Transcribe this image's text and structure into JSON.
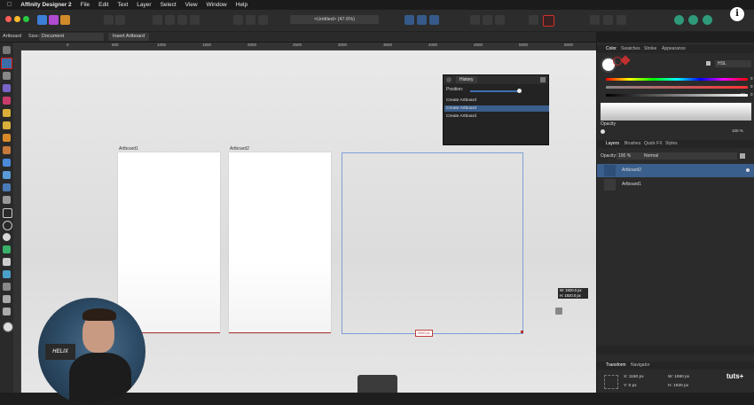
{
  "menubar": {
    "apple": "",
    "items": [
      "Affinity Designer 2",
      "File",
      "Edit",
      "Text",
      "Layer",
      "Select",
      "View",
      "Window",
      "Help"
    ]
  },
  "toolbar": {
    "doc_title": "<Untitled> (47.6%)"
  },
  "context": {
    "artboard_label": "Artboard",
    "size_label": "Size:",
    "size_value": "Document",
    "insert_button": "Insert Artboard"
  },
  "rulers": {
    "top": [
      "0",
      "500",
      "1000",
      "1500",
      "2000",
      "2500",
      "3000",
      "3500",
      "4000",
      "4500",
      "5000",
      "5500",
      "6000",
      "6500"
    ]
  },
  "canvas": {
    "artboards": [
      {
        "label": "Artboard1"
      },
      {
        "label": "Artboard2"
      }
    ],
    "dimension_tag": "2000 px",
    "tooltip": {
      "w": "W: 1920.0 px",
      "h": "H: 1920.0 px"
    }
  },
  "history": {
    "title": "History",
    "position_label": "Position:",
    "items": [
      "Create Artboard",
      "Create Artboard",
      "Create Artboard"
    ]
  },
  "color_panel": {
    "tabs": [
      "Color",
      "Swatches",
      "Stroke",
      "Appearance"
    ],
    "mode": "HSL",
    "values": [
      "0",
      "0",
      "0",
      "72"
    ],
    "opacity_label": "Opacity",
    "opacity_value": "100 %"
  },
  "layers_panel": {
    "tabs": [
      "Layers",
      "Brushes",
      "Quick FX",
      "Styles"
    ],
    "opacity_label": "Opacity:",
    "opacity_value": "100 %",
    "blend": "Normal",
    "layers": [
      "Artboard2",
      "Artboard1"
    ]
  },
  "transform_panel": {
    "tabs": [
      "Transform",
      "Navigator"
    ],
    "x": "1160 px",
    "y": "0 px",
    "w": "1060 px",
    "h": "1920 px"
  },
  "watermark": "tuts+",
  "colors": {
    "accent": "#3d6fb0",
    "selection": "#3b5f8d",
    "highlight_red": "#e01818"
  }
}
